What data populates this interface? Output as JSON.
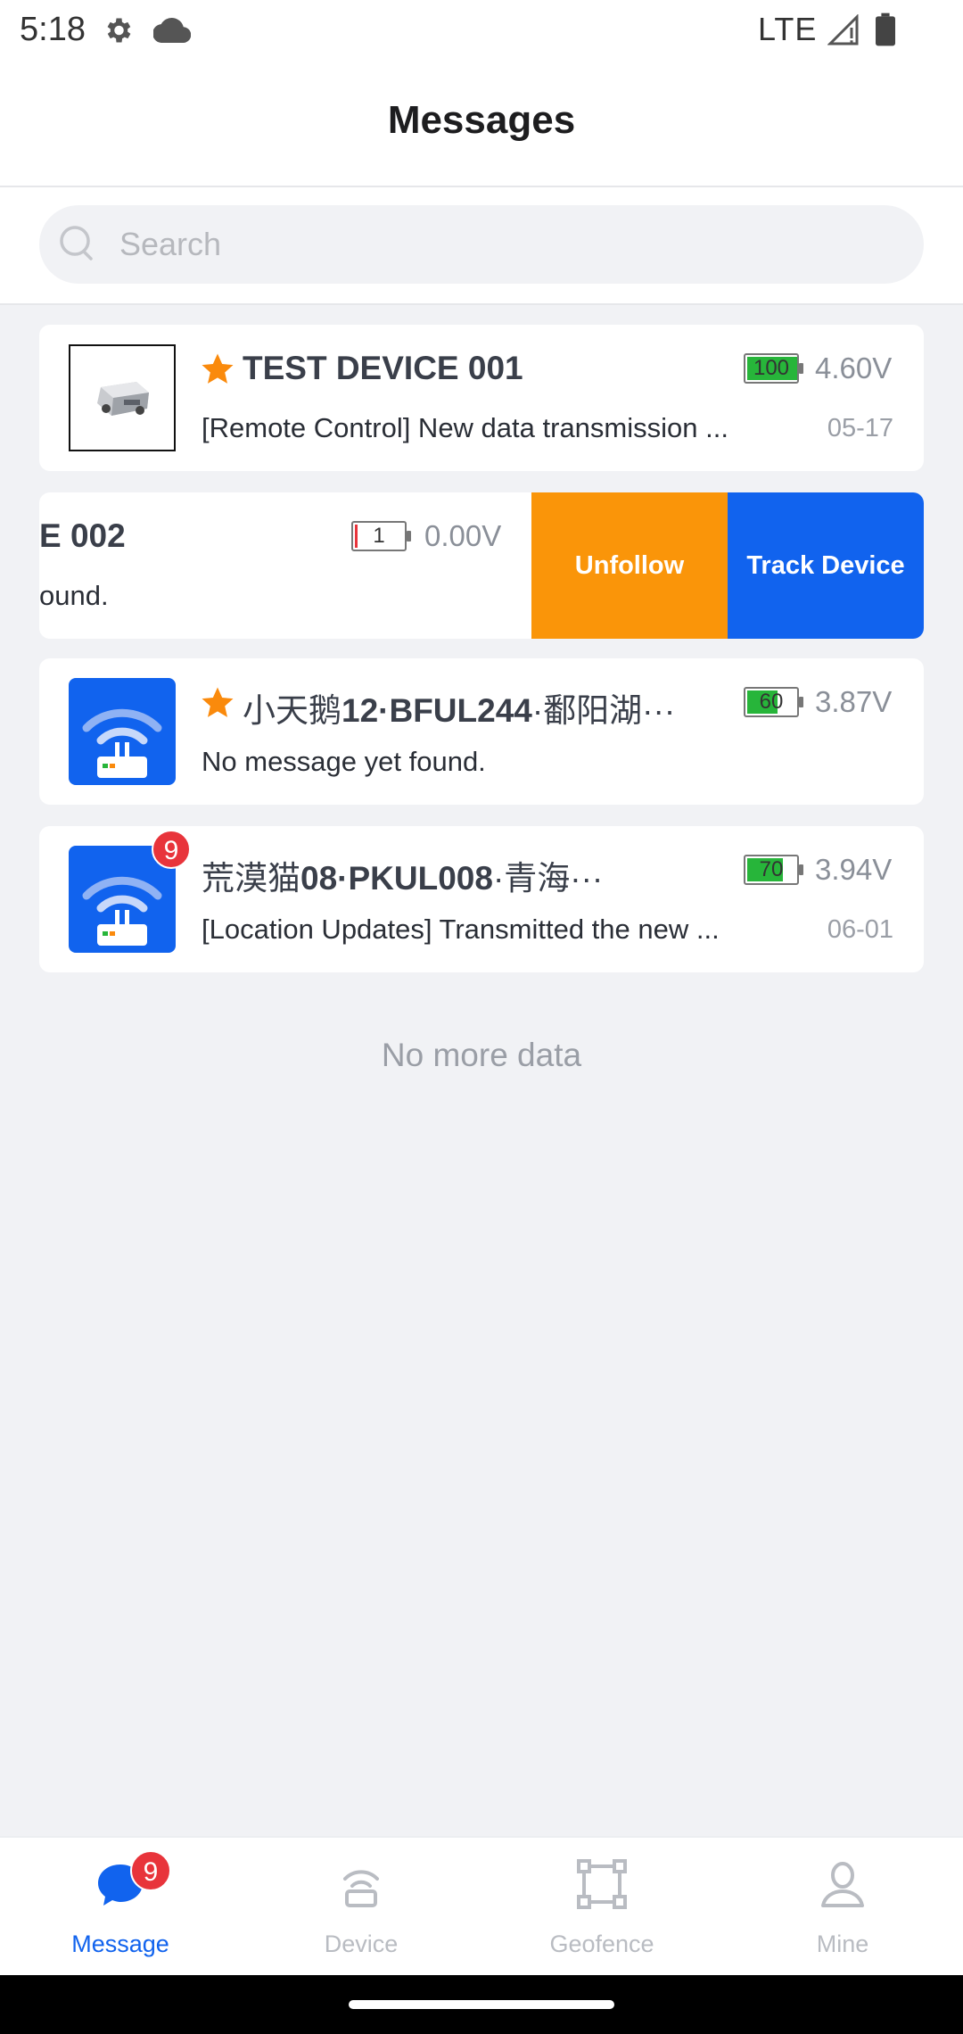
{
  "status_bar": {
    "time": "5:18",
    "network": "LTE",
    "icons": [
      "gear-icon",
      "cloud-icon",
      "signal-icon",
      "battery-icon"
    ]
  },
  "header": {
    "title": "Messages"
  },
  "search": {
    "placeholder": "Search",
    "value": ""
  },
  "devices": [
    {
      "title_prefix": "",
      "title_bold": "TEST DEVICE 001",
      "starred": true,
      "battery_label": "100",
      "battery_level": 1.0,
      "voltage": "4.60V",
      "message": "[Remote Control] New data transmission ...",
      "date": "05-17",
      "thumbnail": "device-photo"
    },
    {
      "title_prefix": "",
      "title_bold": "E 002",
      "starred": false,
      "battery_label": "1",
      "battery_level": 0.01,
      "voltage": "0.00V",
      "message": "ound.",
      "date": "",
      "thumbnail": "",
      "actions": {
        "unfollow": "Unfollow",
        "track": "Track Device"
      }
    },
    {
      "title_prefix": "小天鹅",
      "title_bold": "12·BFUL244",
      "title_suffix": "·鄱阳湖···",
      "starred": true,
      "battery_label": "60",
      "battery_level": 0.6,
      "voltage": "3.87V",
      "message": "No message yet found.",
      "date": "",
      "thumbnail": "wifi-router-icon"
    },
    {
      "title_prefix": "荒漠猫",
      "title_bold": "08·PKUL008",
      "title_suffix": "·青海···",
      "starred": false,
      "unread": "9",
      "battery_label": "70",
      "battery_level": 0.7,
      "voltage": "3.94V",
      "message": "[Location Updates] Transmitted the new ...",
      "date": "06-01",
      "thumbnail": "wifi-router-icon"
    }
  ],
  "list_footer": "No more data",
  "tabbar": {
    "tabs": [
      {
        "label": "Message",
        "icon": "chat-bubble-icon",
        "active": true,
        "badge": "9"
      },
      {
        "label": "Device",
        "icon": "device-icon",
        "active": false
      },
      {
        "label": "Geofence",
        "icon": "geofence-icon",
        "active": false
      },
      {
        "label": "Mine",
        "icon": "user-icon",
        "active": false
      }
    ]
  },
  "colors": {
    "primary": "#1163ee",
    "warning": "#fa9509",
    "badge": "#e8343b",
    "battery_green": "#27b53a",
    "background": "#f1f2f5"
  }
}
